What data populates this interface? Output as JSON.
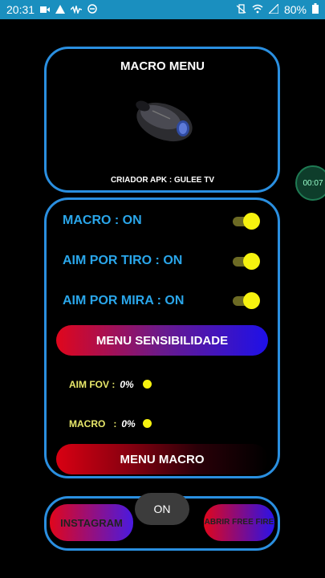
{
  "status_bar": {
    "time": "20:31",
    "battery": "80%"
  },
  "header": {
    "title": "MACRO MENU",
    "creator": "CRIADOR APK : GULEE TV"
  },
  "recording_bubble": {
    "time": "00:07"
  },
  "settings": [
    {
      "label": "MACRO : ON",
      "toggled": true
    },
    {
      "label": "AIM POR TIRO : ON",
      "toggled": true
    },
    {
      "label": "AIM POR MIRA : ON",
      "toggled": true
    }
  ],
  "buttons": {
    "menu_sensibilidade": "MENU SENSIBILIDADE",
    "menu_macro": "MENU MACRO",
    "instagram": "INSTAGRAM",
    "abrir_free_fire": "ABRIR FREE FIRE"
  },
  "stats": [
    {
      "label": "AIM FOV :",
      "value": "0%"
    },
    {
      "label": "MACRO   :",
      "value": "0%"
    }
  ],
  "toast": {
    "text": "ON"
  },
  "colors": {
    "accent_blue": "#2a8fe0",
    "label_blue": "#2aa6ea",
    "toggle_yellow": "#f6f20f",
    "status_bar": "#1a8fbf"
  }
}
